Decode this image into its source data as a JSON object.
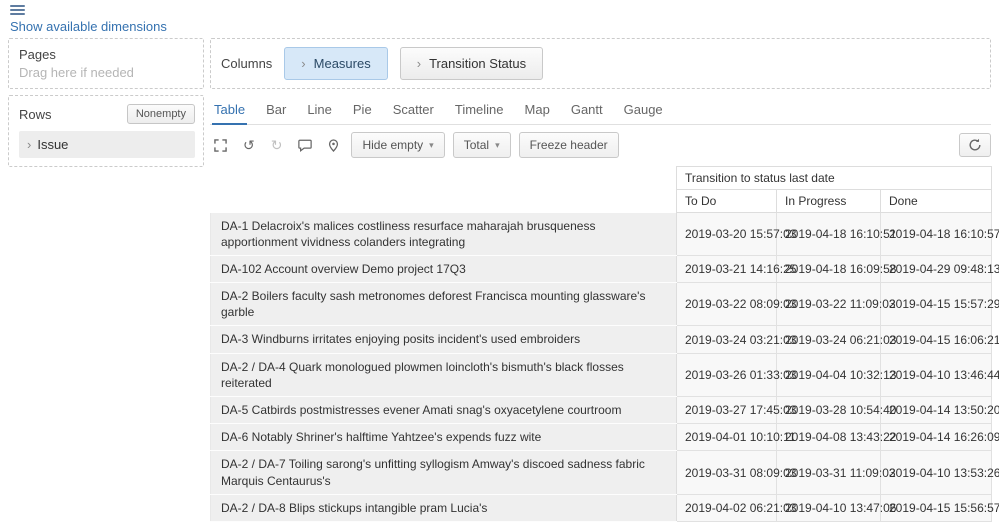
{
  "colors": {
    "accent": "#3572b0",
    "chip_active_bg": "#d7e8f8",
    "chip_active_border": "#a9c9e8"
  },
  "top": {
    "show_dimensions_link": "Show available dimensions"
  },
  "pages_panel": {
    "title": "Pages",
    "placeholder": "Drag here if needed"
  },
  "rows_panel": {
    "title": "Rows",
    "nonempty_button": "Nonempty",
    "dimension": "Issue"
  },
  "columns_panel": {
    "title": "Columns",
    "chips": [
      "Measures",
      "Transition Status"
    ]
  },
  "tabs": [
    "Table",
    "Bar",
    "Line",
    "Pie",
    "Scatter",
    "Timeline",
    "Map",
    "Gantt",
    "Gauge"
  ],
  "toolbar": {
    "hide_empty": "Hide empty",
    "total": "Total",
    "freeze_header": "Freeze header"
  },
  "table": {
    "group_header": "Transition to status last date",
    "columns": [
      "To Do",
      "In Progress",
      "Done"
    ],
    "rows": [
      {
        "label": "DA-1 Delacroix's malices costliness resurface maharajah brusqueness apportionment vividness colanders integrating",
        "values": [
          "2019-03-20 15:57:03",
          "2019-04-18 16:10:51",
          "2019-04-18 16:10:57"
        ]
      },
      {
        "label": "DA-102 Account overview Demo project 17Q3",
        "values": [
          "2019-03-21 14:16:25",
          "2019-04-18 16:09:58",
          "2019-04-29 09:48:13"
        ]
      },
      {
        "label": "DA-2 Boilers faculty sash metronomes deforest Francisca mounting glassware's garble",
        "values": [
          "2019-03-22 08:09:03",
          "2019-03-22 11:09:03",
          "2019-04-15 15:57:29"
        ]
      },
      {
        "label": "DA-3 Windburns irritates enjoying posits incident's used embroiders",
        "values": [
          "2019-03-24 03:21:03",
          "2019-03-24 06:21:03",
          "2019-04-15 16:06:21"
        ]
      },
      {
        "label": "DA-2 / DA-4 Quark monologued plowmen loincloth's bismuth's black flosses reiterated",
        "values": [
          "2019-03-26 01:33:03",
          "2019-04-04 10:32:13",
          "2019-04-10 13:46:44"
        ]
      },
      {
        "label": "DA-5 Catbirds postmistresses evener Amati snag's oxyacetylene courtroom",
        "values": [
          "2019-03-27 17:45:03",
          "2019-03-28 10:54:40",
          "2019-04-14 13:50:20"
        ]
      },
      {
        "label": "DA-6 Notably Shriner's halftime Yahtzee's expends fuzz wite",
        "values": [
          "2019-04-01 10:10:11",
          "2019-04-08 13:43:22",
          "2019-04-14 16:26:09"
        ]
      },
      {
        "label": "DA-2 / DA-7 Toiling sarong's unfitting syllogism Amway's discoed sadness fabric Marquis Centaurus's",
        "values": [
          "2019-03-31 08:09:03",
          "2019-03-31 11:09:03",
          "2019-04-10 13:53:26"
        ]
      },
      {
        "label": "DA-2 / DA-8 Blips stickups intangible pram Lucia's",
        "values": [
          "2019-04-02 06:21:03",
          "2019-04-10 13:47:06",
          "2019-04-15 15:56:57"
        ]
      }
    ]
  }
}
